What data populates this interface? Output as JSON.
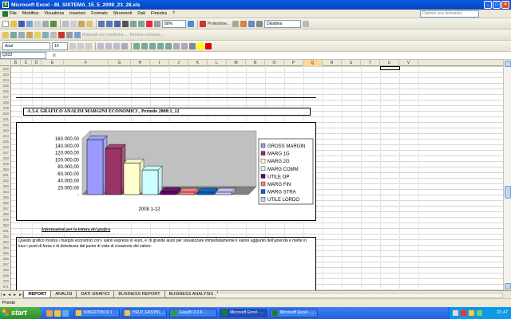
{
  "window": {
    "title": "Microsoft Excel - BI_SISTEMA_15_5_2009_23_28.xls",
    "buttons": [
      "_",
      "□",
      "×"
    ]
  },
  "menu": {
    "items": [
      "File",
      "Modifica",
      "Visualizza",
      "Inserisci",
      "Formato",
      "Strumenti",
      "Dati",
      "Finestra",
      "?"
    ],
    "help_placeholder": "Digitare una domanda."
  },
  "toolbar": {
    "zoom": "80%",
    "protection": "Protezione...",
    "disattiva": "Disattiva",
    "reply": "Rispondi con modifiche...",
    "end_review": "Termina revisione..."
  },
  "format_bar": {
    "font": "Arial",
    "size": "10"
  },
  "formula": {
    "cell_ref": "Q332",
    "fx": "fx",
    "value": ""
  },
  "columns": [
    "B",
    "C",
    "D",
    "E",
    "F",
    "G",
    "H",
    "I",
    "J",
    "K",
    "L",
    "M",
    "N",
    "O",
    "P",
    "Q",
    "R",
    "S",
    "T",
    "U",
    "V"
  ],
  "active_column": "Q",
  "rows": [
    "332",
    "333",
    "334",
    "335",
    "336",
    "337",
    "338",
    "339",
    "340",
    "341",
    "342",
    "343",
    "344",
    "345",
    "346",
    "347",
    "348",
    "349",
    "350",
    "351",
    "352",
    "353",
    "354",
    "355",
    "356",
    "357",
    "358",
    "359",
    "360",
    "361",
    "362",
    "363",
    "364",
    "365",
    "366",
    "367",
    "368",
    "369",
    "370",
    "371"
  ],
  "section": {
    "title": "A.3.4. GRAFICO ANALISI MARGINI ECONOMICI , Periodo 2008:1_12"
  },
  "chart_data": {
    "type": "bar",
    "categories": [
      "2008 1-12"
    ],
    "series": [
      {
        "name": "GROSS MARGIN",
        "values": [
          145000
        ],
        "color": "#9999ff"
      },
      {
        "name": "MARG 1G",
        "values": [
          122000
        ],
        "color": "#993366"
      },
      {
        "name": "MARG 2G",
        "values": [
          83000
        ],
        "color": "#ffffcc"
      },
      {
        "name": "MARG COMM",
        "values": [
          65000
        ],
        "color": "#ccffff"
      },
      {
        "name": "UTILE OP",
        "values": [
          8000
        ],
        "color": "#660066"
      },
      {
        "name": "MARG FIN",
        "values": [
          6000
        ],
        "color": "#ff8080"
      },
      {
        "name": "MARG STRA",
        "values": [
          5000
        ],
        "color": "#0066cc"
      },
      {
        "name": "UTILE LORDO",
        "values": [
          6000
        ],
        "color": "#ccccff"
      }
    ],
    "yticks": [
      "160.000,00",
      "140.000,00",
      "120.000,00",
      "100.000,00",
      "80.000,00",
      "60.000,00",
      "40.000,00",
      "20.000,00",
      "-"
    ],
    "ylim": [
      0,
      160000
    ],
    "legend": "right",
    "grid": false,
    "chart_type_detail": "3d clustered column"
  },
  "notes": {
    "label": "Informazioni per la lettura del grafico",
    "text": "Questo grafico mostra i margini economici con i valori espressi in euro, e' di grande aiuto per visualizzare immediatamente il valore aggiunto dell'azienda e mette in luce i punti di forza e di debolezza dal punto di vista di creazione del valore."
  },
  "sheets": {
    "tabs": [
      "REPORT",
      "ANALISI",
      "DATI GRAFICI",
      "BUSINESS REPORT",
      "BUSINESS ANALYSIS"
    ],
    "active": "REPORT"
  },
  "status": {
    "text": "Pronto"
  },
  "taskbar": {
    "start": "start",
    "tasks": [
      "KINGSTON (F:)",
      "HELP_EASYBI_...",
      "EasyBI 2.0.6 ...",
      "Microsoft Excel - ...",
      "Microsoft Excel - ..."
    ],
    "clock": "23.47"
  },
  "colors": {
    "titlebar": "#0a5ce6",
    "taskbar": "#245edb",
    "start": "#3c9a35",
    "chrome": "#ece9d8"
  }
}
